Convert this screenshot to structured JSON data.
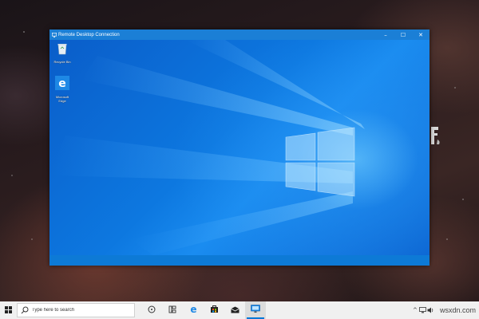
{
  "host": {
    "background": "space-nebula",
    "taskbar": {
      "start_icon": "windows-logo-icon",
      "search_placeholder": "Type here to search",
      "pinned": [
        {
          "name": "task-view-icon"
        },
        {
          "name": "timeline-icon"
        },
        {
          "name": "edge-icon"
        },
        {
          "name": "store-icon"
        },
        {
          "name": "mail-icon"
        },
        {
          "name": "remote-desktop-icon",
          "active": true
        }
      ],
      "tray": {
        "chevron": "^",
        "watermark": "wsxdn.com"
      }
    }
  },
  "rdp_window": {
    "title": "Remote Desktop Connection",
    "controls": {
      "minimize": "–",
      "maximize": "☐",
      "close": "✕"
    },
    "remote_desktop": {
      "icons": [
        {
          "label": "Recycle Bin",
          "icon": "recycle-bin-icon"
        },
        {
          "label": "Microsoft Edge",
          "icon": "edge-icon"
        }
      ]
    }
  },
  "colors": {
    "accent": "#0078d7",
    "titlebar": "#1b7fd6",
    "host_taskbar": "#f0f0f0"
  }
}
